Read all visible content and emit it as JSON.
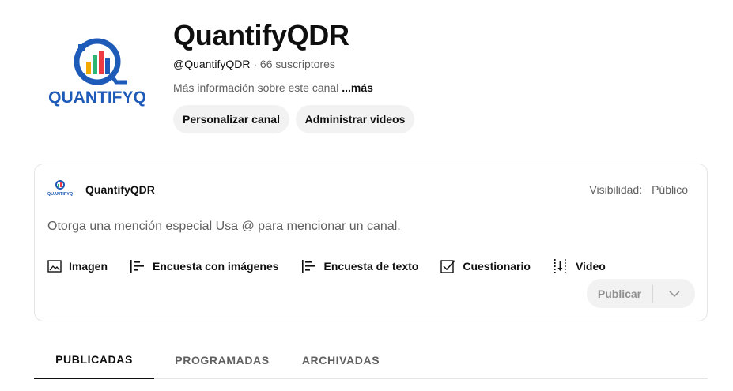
{
  "channel": {
    "title": "QuantifyQDR",
    "handle": "@QuantifyQDR",
    "separator": " · ",
    "subscribers": "66 suscriptores",
    "description": "Más información sobre este canal ",
    "more": "...más",
    "logo_text": "QUANTIFYQ",
    "brand_color": "#1e5bb8"
  },
  "actions": {
    "customize": "Personalizar canal",
    "manage": "Administrar videos"
  },
  "composer": {
    "author": "QuantifyQDR",
    "visibility_label": "Visibilidad:",
    "visibility_value": "Público",
    "placeholder": "Otorga una mención especial Usa @ para mencionar un canal.",
    "tools": [
      {
        "label": "Imagen",
        "icon": "image-icon"
      },
      {
        "label": "Encuesta con imágenes",
        "icon": "image-poll-icon"
      },
      {
        "label": "Encuesta de texto",
        "icon": "text-poll-icon"
      },
      {
        "label": "Cuestionario",
        "icon": "quiz-icon"
      },
      {
        "label": "Video",
        "icon": "video-icon"
      }
    ],
    "publish": "Publicar"
  },
  "tabs": [
    {
      "label": "PUBLICADAS",
      "active": true
    },
    {
      "label": "PROGRAMADAS",
      "active": false
    },
    {
      "label": "ARCHIVADAS",
      "active": false
    }
  ]
}
